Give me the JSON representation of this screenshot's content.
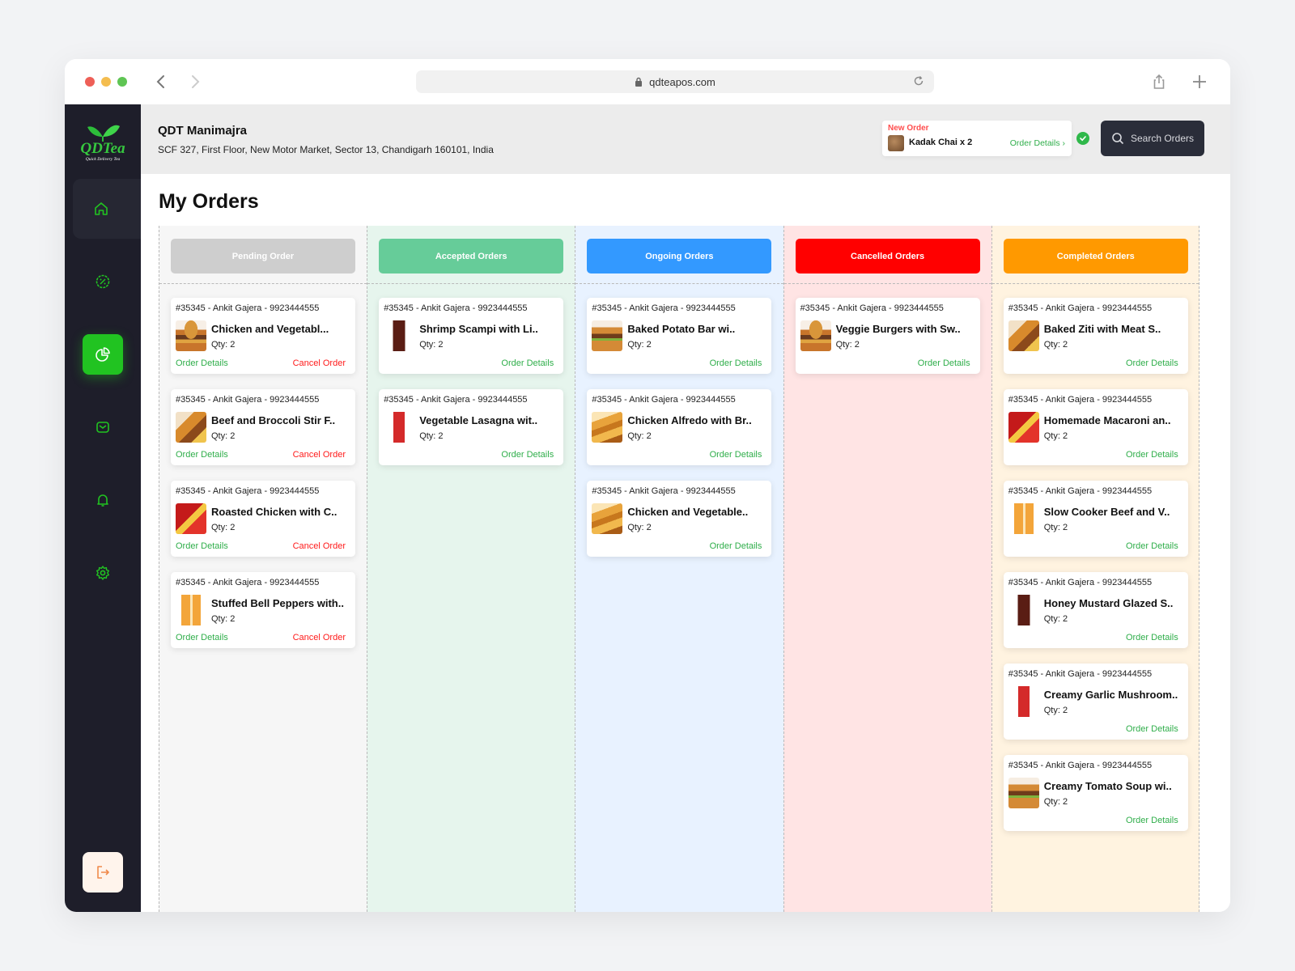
{
  "browser": {
    "url": "qdteapos.com"
  },
  "sidebar": {
    "logo": "QDTea",
    "logo_tagline": "Quick Delivery Tea",
    "items": [
      {
        "name": "home",
        "icon": "home-icon"
      },
      {
        "name": "discount",
        "icon": "badge-percent-icon"
      },
      {
        "name": "orders",
        "icon": "pie-chart-icon",
        "active": true
      },
      {
        "name": "messages",
        "icon": "mail-icon"
      },
      {
        "name": "notifications",
        "icon": "bell-icon"
      },
      {
        "name": "settings",
        "icon": "gear-icon"
      }
    ],
    "logout_icon": "logout-icon"
  },
  "header": {
    "store_name": "QDT Manimajra",
    "store_address": "SCF 327, First Floor, New Motor Market, Sector 13, Chandigarh 160101, India",
    "new_order": {
      "title": "New Order",
      "item": "Kadak Chai x 2",
      "link": "Order Details ›"
    },
    "search_label": "Search Orders"
  },
  "page": {
    "title": "My Orders"
  },
  "colors": {
    "accent": "#21c321",
    "sidebar": "#1e1e2a",
    "link_green": "#2fae4a",
    "cancel_red": "#ff1a1a"
  },
  "board": {
    "columns": [
      {
        "label": "Pending Order",
        "color": "#cecece",
        "bg": "#f6f6f6",
        "cancellable": true,
        "cards": [
          {
            "id": "#35345 - Ankit Gajera - 9923444555",
            "item": "Chicken and Vegetabl...",
            "qty": "Qty: 2",
            "thumb": "burger",
            "details": "Order Details",
            "cancel": "Cancel Order"
          },
          {
            "id": "#35345 - Ankit Gajera - 9923444555",
            "item": "Beef and Broccoli Stir F..",
            "qty": "Qty: 2",
            "thumb": "combo",
            "details": "Order Details",
            "cancel": "Cancel Order"
          },
          {
            "id": "#35345 - Ankit Gajera - 9923444555",
            "item": "Roasted Chicken with C..",
            "qty": "Qty: 2",
            "thumb": "redbox",
            "details": "Order Details",
            "cancel": "Cancel Order"
          },
          {
            "id": "#35345 - Ankit Gajera - 9923444555",
            "item": "Stuffed Bell Peppers with..",
            "qty": "Qty: 2",
            "thumb": "orange",
            "details": "Order Details",
            "cancel": "Cancel Order"
          }
        ]
      },
      {
        "label": "Accepted Orders",
        "color": "#66cc99",
        "bg": "#e6f5ed",
        "cancellable": false,
        "cards": [
          {
            "id": "#35345 - Ankit Gajera - 9923444555",
            "item": "Shrimp Scampi with Li..",
            "qty": "Qty: 2",
            "thumb": "cola",
            "details": "Order Details"
          },
          {
            "id": "#35345 - Ankit Gajera - 9923444555",
            "item": "Vegetable Lasagna wit..",
            "qty": "Qty: 2",
            "thumb": "red",
            "details": "Order Details"
          }
        ]
      },
      {
        "label": "Ongoing Orders",
        "color": "#3399ff",
        "bg": "#e8f2ff",
        "cancellable": false,
        "cards": [
          {
            "id": "#35345 - Ankit Gajera - 9923444555",
            "item": "Baked Potato Bar wi..",
            "qty": "Qty: 2",
            "thumb": "burger2",
            "details": "Order Details"
          },
          {
            "id": "#35345 - Ankit Gajera - 9923444555",
            "item": "Chicken Alfredo with Br..",
            "qty": "Qty: 2",
            "thumb": "fries",
            "details": "Order Details"
          },
          {
            "id": "#35345 - Ankit Gajera - 9923444555",
            "item": "Chicken and Vegetable..",
            "qty": "Qty: 2",
            "thumb": "fries",
            "details": "Order Details"
          }
        ]
      },
      {
        "label": "Cancelled Orders",
        "color": "#ff0000",
        "bg": "#ffe4e4",
        "cancellable": false,
        "cards": [
          {
            "id": "#35345 - Ankit Gajera - 9923444555",
            "item": "Veggie Burgers with Sw..",
            "qty": "Qty: 2",
            "thumb": "burger",
            "details": "Order Details"
          }
        ]
      },
      {
        "label": "Completed Orders",
        "color": "#ff9900",
        "bg": "#fff3e0",
        "cancellable": false,
        "cards": [
          {
            "id": "#35345 - Ankit Gajera - 9923444555",
            "item": "Baked Ziti with Meat S..",
            "qty": "Qty: 2",
            "thumb": "combo",
            "details": "Order Details"
          },
          {
            "id": "#35345 - Ankit Gajera - 9923444555",
            "item": "Homemade Macaroni an..",
            "qty": "Qty: 2",
            "thumb": "redbox",
            "details": "Order Details"
          },
          {
            "id": "#35345 - Ankit Gajera - 9923444555",
            "item": "Slow Cooker Beef and V..",
            "qty": "Qty: 2",
            "thumb": "orange",
            "details": "Order Details"
          },
          {
            "id": "#35345 - Ankit Gajera - 9923444555",
            "item": "Honey Mustard Glazed S..",
            "qty": "Qty: 2",
            "thumb": "cola",
            "details": "Order Details"
          },
          {
            "id": "#35345 - Ankit Gajera - 9923444555",
            "item": "Creamy Garlic Mushroom..",
            "qty": "Qty: 2",
            "thumb": "red",
            "details": "Order Details"
          },
          {
            "id": "#35345 - Ankit Gajera - 9923444555",
            "item": "Creamy Tomato Soup wi..",
            "qty": "Qty: 2",
            "thumb": "burger2",
            "details": "Order Details"
          }
        ]
      }
    ]
  }
}
